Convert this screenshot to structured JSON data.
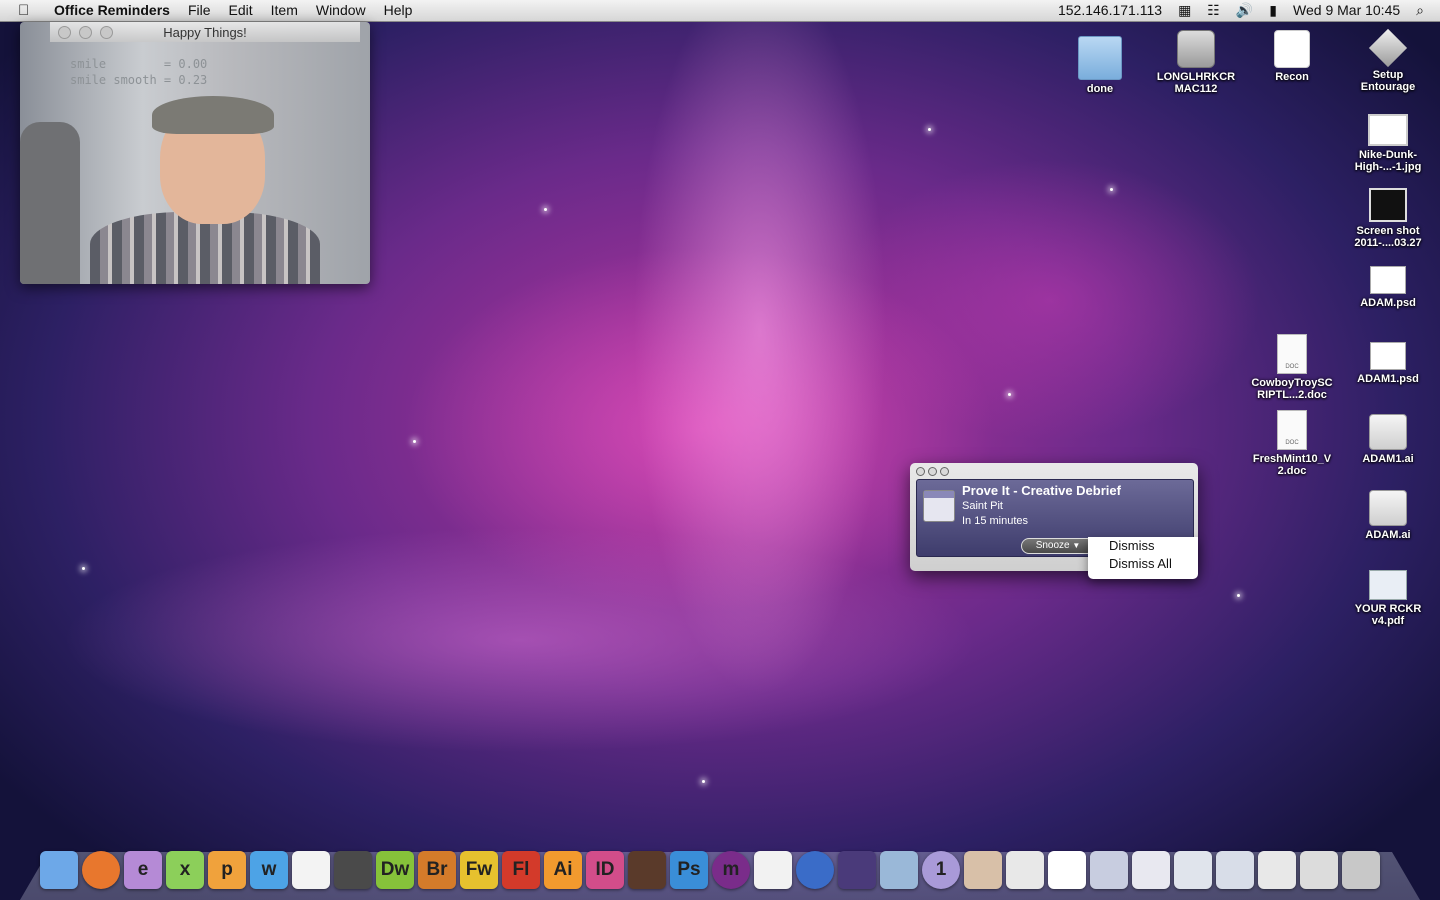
{
  "menubar": {
    "app_name": "Office Reminders",
    "menus": [
      "File",
      "Edit",
      "Item",
      "Window",
      "Help"
    ],
    "ip_address": "152.146.171.113",
    "datetime": "Wed 9 Mar  10:45"
  },
  "happy_window": {
    "title": "Happy Things!",
    "overlay_line1": "smile        = 0.00",
    "overlay_line2": "smile smooth = 0.23"
  },
  "desktop_icons": [
    {
      "label": "done",
      "icon": "folder-icon"
    },
    {
      "label": "LONGLHRKCR\nMAC112",
      "icon": "drive-icon"
    },
    {
      "label": "Recon",
      "icon": "recon-app-icon"
    },
    {
      "label": "Setup\nEntourage",
      "icon": "setup-icon"
    },
    {
      "label": "Nike-Dunk-\nHigh-...-1.jpg",
      "icon": "image-file-icon"
    },
    {
      "label": "Screen shot\n2011-....03.27",
      "icon": "screenshot-file-icon"
    },
    {
      "label": "ADAM.psd",
      "icon": "psd-file-icon"
    },
    {
      "label": "CowboyTroySC\nRIPTL...2.doc",
      "icon": "doc-file-icon"
    },
    {
      "label": "ADAM1.psd",
      "icon": "psd-file-icon"
    },
    {
      "label": "FreshMint10_V\n2.doc",
      "icon": "doc-file-icon"
    },
    {
      "label": "ADAM1.ai",
      "icon": "ai-file-icon"
    },
    {
      "label": "ADAM.ai",
      "icon": "ai-file-icon"
    },
    {
      "label": "YOUR RCKR\nv4.pdf",
      "icon": "pdf-file-icon"
    }
  ],
  "reminder": {
    "title": "Prove It - Creative Debrief",
    "location": "Saint Pit",
    "when": "In 15 minutes",
    "snooze_label": "Snooze",
    "menu_options": [
      "Dismiss",
      "Dismiss All"
    ]
  },
  "dock": [
    {
      "label": "",
      "icon": "finder-icon",
      "color": "#6da8e8"
    },
    {
      "label": "",
      "icon": "firefox-icon",
      "color": "#e8772d"
    },
    {
      "label": "e",
      "icon": "edge-animate-icon",
      "color": "#b58ad6"
    },
    {
      "label": "x",
      "icon": "excel-icon",
      "color": "#8ccf5a"
    },
    {
      "label": "p",
      "icon": "powerpoint-icon",
      "color": "#f0a23c"
    },
    {
      "label": "w",
      "icon": "word-icon",
      "color": "#4da3e6"
    },
    {
      "label": "",
      "icon": "acrobat-icon",
      "color": "#f3f3f3"
    },
    {
      "label": "",
      "icon": "acrobat-pro-icon",
      "color": "#4a4a4a"
    },
    {
      "label": "Dw",
      "icon": "dreamweaver-icon",
      "color": "#86c23a"
    },
    {
      "label": "Br",
      "icon": "bridge-icon",
      "color": "#d47b2a"
    },
    {
      "label": "Fw",
      "icon": "fireworks-icon",
      "color": "#e6c12e"
    },
    {
      "label": "Fl",
      "icon": "flash-icon",
      "color": "#d33a2a"
    },
    {
      "label": "Ai",
      "icon": "illustrator-icon",
      "color": "#f29a2e"
    },
    {
      "label": "ID",
      "icon": "indesign-icon",
      "color": "#d24d8a"
    },
    {
      "label": "",
      "icon": "film-icon",
      "color": "#5a3a2a"
    },
    {
      "label": "Ps",
      "icon": "photoshop-icon",
      "color": "#3a8ed8"
    },
    {
      "label": "m",
      "icon": "messenger-icon",
      "color": "#7a2c8a"
    },
    {
      "label": "",
      "icon": "app-store-icon",
      "color": "#f2f2f2"
    },
    {
      "label": "",
      "icon": "itunes-icon",
      "color": "#3a6cc8"
    },
    {
      "label": "",
      "icon": "my-day-icon",
      "color": "#4a3a7a"
    },
    {
      "label": "",
      "icon": "iphoto-icon",
      "color": "#9ab8d8"
    },
    {
      "label": "1",
      "icon": "alarm-icon",
      "color": "#a99ad8"
    },
    {
      "label": "",
      "icon": "cat-icon",
      "color": "#d8c0a8"
    },
    {
      "label": "",
      "icon": "documents-stack-icon",
      "color": "#e8e8e8"
    },
    {
      "label": "",
      "icon": "blank-doc-icon",
      "color": "#ffffff"
    },
    {
      "label": "",
      "icon": "window-thumb-icon",
      "color": "#c8cde0"
    },
    {
      "label": "",
      "icon": "window-thumb-icon",
      "color": "#e8e8f0"
    },
    {
      "label": "",
      "icon": "window-thumb-icon",
      "color": "#e0e4ec"
    },
    {
      "label": "",
      "icon": "window-thumb-icon",
      "color": "#d8dde8"
    },
    {
      "label": "",
      "icon": "window-thumb-icon",
      "color": "#e8e8e8"
    },
    {
      "label": "",
      "icon": "window-thumb-icon",
      "color": "#dcdcdc"
    },
    {
      "label": "",
      "icon": "trash-icon",
      "color": "#c8c8c8"
    }
  ]
}
